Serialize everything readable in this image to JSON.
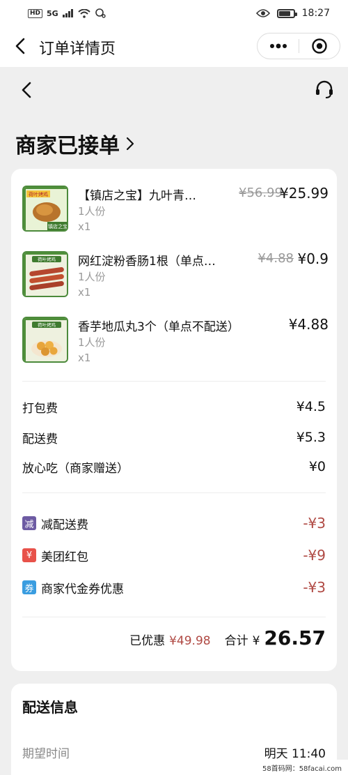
{
  "status_bar": {
    "hd": "HD",
    "network": "5G",
    "time": "18:27",
    "battery_level": 0.8
  },
  "mini_program": {
    "title": "订单详情页",
    "more_icon": "more-dots-icon",
    "close_icon": "target-close-icon"
  },
  "order": {
    "status": "商家已接单",
    "items": [
      {
        "name": "【镇店之宝】九叶青…",
        "portion": "1人份",
        "qty": "x1",
        "original_price": "¥56.99",
        "price": "¥25.99",
        "thumb_text": "荷叶烤鸡",
        "thumb_sub": "镇店之宝"
      },
      {
        "name": "网红淀粉香肠1根（单点不…",
        "portion": "1人份",
        "qty": "x1",
        "original_price": "¥4.88",
        "price": "¥0.9",
        "thumb_text": "荷叶烤鸡"
      },
      {
        "name": "香芋地瓜丸3个（单点不配送）",
        "portion": "1人份",
        "qty": "x1",
        "original_price": "",
        "price": "¥4.88",
        "thumb_text": "荷叶烤鸡"
      }
    ],
    "fees": [
      {
        "label": "打包费",
        "value": "¥4.5"
      },
      {
        "label": "配送费",
        "value": "¥5.3"
      },
      {
        "label": "放心吃（商家赠送）",
        "value": "¥0"
      }
    ],
    "discounts": [
      {
        "tag": "减",
        "tag_color": "#6d5ba3",
        "label": "减配送费",
        "value": "-¥3"
      },
      {
        "tag": "¥",
        "tag_color": "#e8524a",
        "label": "美团红包",
        "value": "-¥9"
      },
      {
        "tag": "券",
        "tag_color": "#3a9de0",
        "label": "商家代金券优惠",
        "value": "-¥3"
      }
    ],
    "summary": {
      "saved_label": "已优惠",
      "saved_value": "¥49.98",
      "total_label": "合计",
      "currency": "¥",
      "total_value": "26.57"
    }
  },
  "delivery": {
    "title": "配送信息",
    "expected_label": "期望时间",
    "expected_value": "明天 11:40"
  },
  "watermark": "58首码网：58facai.com",
  "colors": {
    "discount_red": "#b04a44",
    "muted": "#999999",
    "background": "#efefef"
  }
}
